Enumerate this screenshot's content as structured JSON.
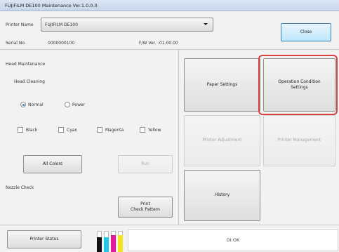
{
  "window": {
    "title": "FUJIFILM DE100 Maintenance Ver.1.0.0.0"
  },
  "header": {
    "printer_name_label": "Printer Name",
    "printer_name_value": "FUJIFILM DE100",
    "close_label": "Close",
    "serial_label": "Serial No.",
    "serial_value": "0000000100",
    "fw_label": "F/W Ver. :",
    "fw_value": "01.00.00"
  },
  "head_maintenance": {
    "title": "Head Maintenance",
    "head_cleaning_label": "Head Cleaning",
    "modes": [
      {
        "label": "Normal",
        "selected": true
      },
      {
        "label": "Power",
        "selected": false
      }
    ],
    "colors": [
      {
        "label": "Black",
        "checked": false
      },
      {
        "label": "Cyan",
        "checked": false
      },
      {
        "label": "Magenta",
        "checked": false
      },
      {
        "label": "Yellow",
        "checked": false
      }
    ],
    "all_colors_label": "All Colors",
    "run_label": "Run",
    "nozzle_check_label": "Nozzle Check",
    "print_check_pattern_label": "Print\nCheck Pattern"
  },
  "right_panel": {
    "paper_settings_label": "Paper Settings",
    "operation_condition_label": "Operation Condition\nSettings",
    "printer_adjustment_label": "Printer Adjustment",
    "printer_management_label": "Printer Management",
    "history_label": "History"
  },
  "status": {
    "printer_status_label": "Printer Status",
    "message": "DI:OK",
    "inks": [
      {
        "name": "black",
        "color": "#111111",
        "level": 0.7
      },
      {
        "name": "cyan",
        "color": "#22c7e6",
        "level": 0.7
      },
      {
        "name": "magenta",
        "color": "#e5179a",
        "level": 0.8
      },
      {
        "name": "yellow",
        "color": "#f3e41d",
        "level": 0.8
      }
    ]
  },
  "colors": {
    "highlight": "#d9413f",
    "accent": "#3c7fb1"
  }
}
